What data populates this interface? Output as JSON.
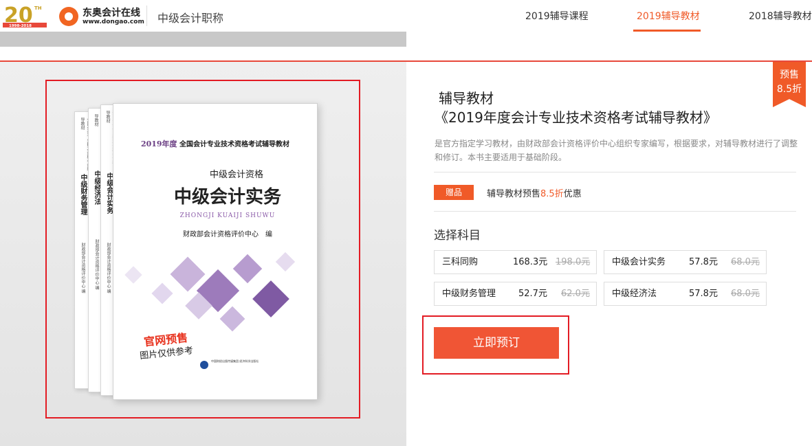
{
  "header": {
    "anniversary_logo": {
      "big": "20",
      "sup": "TH",
      "years": "1998-2018"
    },
    "brand_name": "东奥会计在线",
    "brand_url": "www.dongao.com",
    "section_title": "中级会计职称",
    "nav": [
      {
        "label": "2019辅导课程",
        "active": false
      },
      {
        "label": "2019辅导教材",
        "active": true
      },
      {
        "label": "2018辅导教材",
        "active": false
      }
    ]
  },
  "book_image": {
    "cover": {
      "year": "2019年度",
      "series": "全国会计专业技术资格考试辅导教材",
      "level": "中级会计资格",
      "title": "中级会计实务",
      "pinyin": "ZHONGJI KUAIJI SHUWU",
      "editor": "财政部会计资格评价中心　编",
      "presale": "官网预售",
      "reference": "图片仅供参考",
      "publisher": "中国财经出版传媒集团 经济科学出版社"
    },
    "spines": [
      {
        "title": "中级财务管理",
        "series": "全国会计专业技术资格考试辅导教材",
        "editor": "财政部会计资格评价中心 编"
      },
      {
        "title": "中级经济法",
        "series": "全国会计专业技术资格考试辅导教材",
        "editor": "财政部会计资格评价中心 编"
      },
      {
        "title": "中级会计实务",
        "series": "全国会计专业技术资格考试辅导教材",
        "editor": "财政部会计资格评价中心 编"
      }
    ]
  },
  "badge": {
    "line1": "预售",
    "line2": "8.5折"
  },
  "product": {
    "title_line1": "辅导教材",
    "title_line2": "《2019年度会计专业技术资格考试辅导教材》",
    "description": "是官方指定学习教材，由财政部会计资格评价中心组织专家编写，根据要求，对辅导教材进行了调整和修订。本书主要适用于基础阶段。"
  },
  "gift": {
    "tag": "赠品",
    "text_before": "辅导教材预售",
    "highlight": "8.5折",
    "text_after": "优惠"
  },
  "options": {
    "label": "选择科目",
    "items": [
      {
        "name": "三科同购",
        "price": "168.3元",
        "original": "198.0元"
      },
      {
        "name": "中级会计实务",
        "price": "57.8元",
        "original": "68.0元"
      },
      {
        "name": "中级财务管理",
        "price": "52.7元",
        "original": "62.0元"
      },
      {
        "name": "中级经济法",
        "price": "57.8元",
        "original": "68.0元"
      }
    ]
  },
  "actions": {
    "order_label": "立即预订"
  },
  "colors": {
    "accent": "#f05a28",
    "highlight_frame": "#e31b23",
    "button": "#f05535"
  }
}
